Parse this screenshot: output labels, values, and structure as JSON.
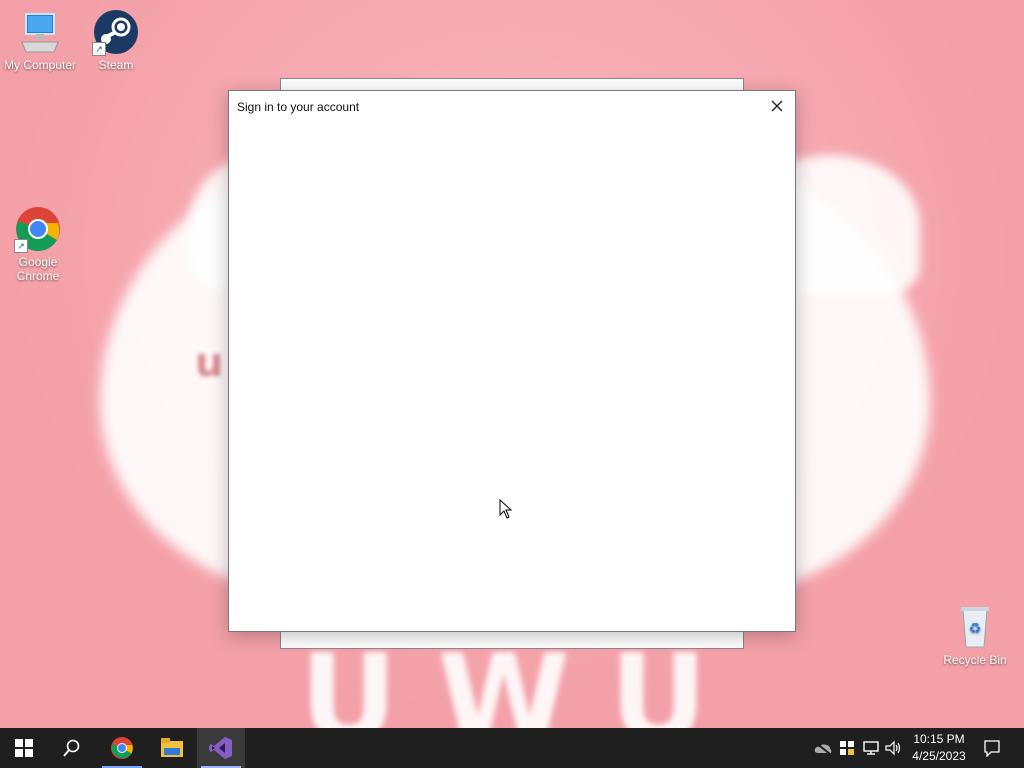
{
  "desktop": {
    "icons": [
      {
        "label": "My Computer",
        "icon": "computer-icon"
      },
      {
        "label": "Steam",
        "icon": "steam-icon"
      },
      {
        "label": "Google Chrome",
        "icon": "chrome-icon"
      },
      {
        "label": "Recycle Bin",
        "icon": "recycle-bin-icon"
      }
    ],
    "wallpaper_text": "UWU",
    "wallpaper_small_text": "u"
  },
  "dialog": {
    "title": "Sign in to your account",
    "close_icon": "close-icon"
  },
  "taskbar": {
    "buttons": [
      {
        "icon": "windows-start-icon"
      },
      {
        "icon": "search-icon"
      },
      {
        "icon": "chrome-icon"
      },
      {
        "icon": "file-explorer-icon"
      },
      {
        "icon": "visual-studio-icon",
        "active": true
      }
    ],
    "tray": [
      {
        "icon": "onedrive-icon"
      },
      {
        "icon": "security-shield-icon"
      },
      {
        "icon": "network-icon"
      },
      {
        "icon": "volume-icon"
      }
    ],
    "clock": {
      "time": "10:15 PM",
      "date": "4/25/2023"
    },
    "notification_icon": "action-center-icon"
  },
  "colors": {
    "wallpaper": "#f6a7ad",
    "taskbar": "#1f1f1f",
    "dialog_bg": "#ffffff"
  }
}
